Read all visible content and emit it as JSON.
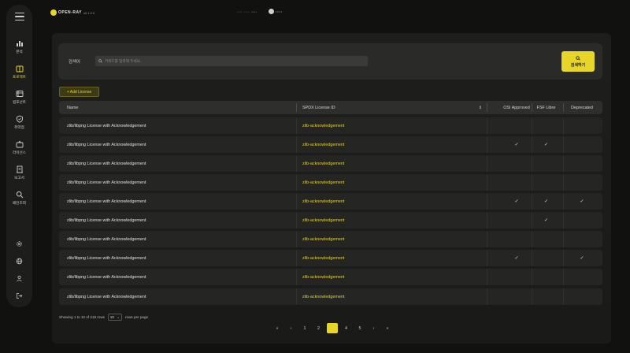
{
  "header": {
    "logo_text": "OPEN-RAY",
    "logo_version": "v6 1.0.0",
    "breadcrumbs": [
      "• • • •",
      "• • • •",
      "• • • •"
    ],
    "user_name": "• • • •"
  },
  "sidebar": {
    "items": [
      {
        "label": "분석",
        "icon": "bar-chart-icon",
        "active": false
      },
      {
        "label": "프로젝트",
        "icon": "folder-icon",
        "active": true
      },
      {
        "label": "컴포넌트",
        "icon": "component-icon",
        "active": false
      },
      {
        "label": "취약점",
        "icon": "shield-icon",
        "active": false
      },
      {
        "label": "라이선스",
        "icon": "license-icon",
        "active": false
      },
      {
        "label": "보고서",
        "icon": "report-icon",
        "active": false
      },
      {
        "label": "패턴조회",
        "icon": "search-icon",
        "active": false
      }
    ],
    "bottom_icons": [
      "settings-icon",
      "globe-icon",
      "user-icon",
      "logout-icon"
    ]
  },
  "search": {
    "label": "검색어",
    "placeholder": "키워드를 입력해 주세요.",
    "button_label": "검색하기"
  },
  "add_button_label": "+ Add License",
  "table": {
    "headers": {
      "name": "Name",
      "spdx": "SPDX License ID",
      "sort_icon": "⇕",
      "osi": "OSI Approved",
      "fsf": "FSF Libre",
      "deprecated": "Deprecated"
    },
    "rows": [
      {
        "name": "zlib/libpng License with Acknowledgement",
        "spdx": "zlib-acknowledgement",
        "osi": "",
        "fsf": "",
        "dep": ""
      },
      {
        "name": "zlib/libpng License with Acknowledgement",
        "spdx": "zlib-acknowledgement",
        "osi": "✓",
        "fsf": "✓",
        "dep": ""
      },
      {
        "name": "zlib/libpng License with Acknowledgement",
        "spdx": "zlib-acknowledgement",
        "osi": "",
        "fsf": "",
        "dep": ""
      },
      {
        "name": "zlib/libpng License with Acknowledgement",
        "spdx": "zlib-acknowledgement",
        "osi": "",
        "fsf": "",
        "dep": ""
      },
      {
        "name": "zlib/libpng License with Acknowledgement",
        "spdx": "zlib-acknowledgement",
        "osi": "✓",
        "fsf": "✓",
        "dep": "✓"
      },
      {
        "name": "zlib/libpng License with Acknowledgement",
        "spdx": "zlib-acknowledgement",
        "osi": "",
        "fsf": "✓",
        "dep": ""
      },
      {
        "name": "zlib/libpng License with Acknowledgement",
        "spdx": "zlib-acknowledgement",
        "osi": "",
        "fsf": "",
        "dep": ""
      },
      {
        "name": "zlib/libpng License with Acknowledgement",
        "spdx": "zlib-acknowledgement",
        "osi": "✓",
        "fsf": "",
        "dep": "✓"
      },
      {
        "name": "zlib/libpng License with Acknowledgement",
        "spdx": "zlib-acknowledgement",
        "osi": "",
        "fsf": "",
        "dep": ""
      },
      {
        "name": "zlib/libpng License with Acknowledgement",
        "spdx": "zlib-acknowledgement",
        "osi": "",
        "fsf": "",
        "dep": ""
      }
    ]
  },
  "footer": {
    "showing_text": "Showing 1 to 10 of 218 rows",
    "rows_value": "10",
    "rows_suffix": "rows per page"
  },
  "pagination": {
    "first": "«",
    "prev": "‹",
    "pages": [
      "1",
      "2",
      "3",
      "4",
      "5"
    ],
    "current": "3",
    "next": "›",
    "last": "»"
  },
  "colors": {
    "accent": "#e8d52a",
    "background": "#111110",
    "panel": "#1e1e1c"
  }
}
